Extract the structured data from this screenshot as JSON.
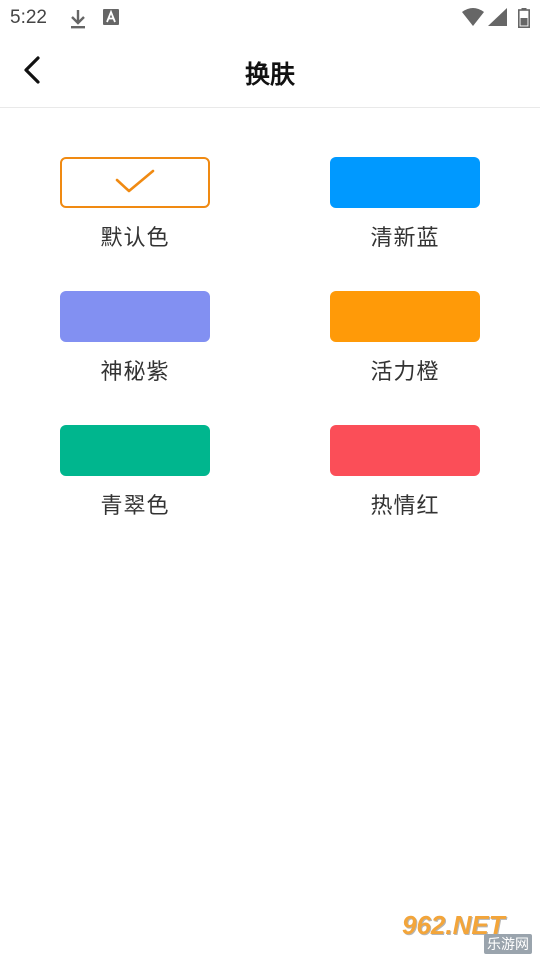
{
  "status_bar": {
    "time": "5:22",
    "icons": [
      "download-icon",
      "font-a-icon",
      "wifi-icon",
      "signal-icon",
      "battery-icon"
    ]
  },
  "header": {
    "title": "换肤",
    "back_icon": "chevron-left-icon"
  },
  "themes": [
    {
      "label": "默认色",
      "color": "#ffffff",
      "border": "#f08a12",
      "selected": true
    },
    {
      "label": "清新蓝",
      "color": "#0099ff",
      "selected": false
    },
    {
      "label": "神秘紫",
      "color": "#8290f2",
      "selected": false
    },
    {
      "label": "活力橙",
      "color": "#ff9a08",
      "selected": false
    },
    {
      "label": "青翠色",
      "color": "#00b68e",
      "selected": false
    },
    {
      "label": "热情红",
      "color": "#fb4e58",
      "selected": false
    }
  ],
  "watermark": {
    "top": "962.NET",
    "bottom": "乐游网"
  }
}
